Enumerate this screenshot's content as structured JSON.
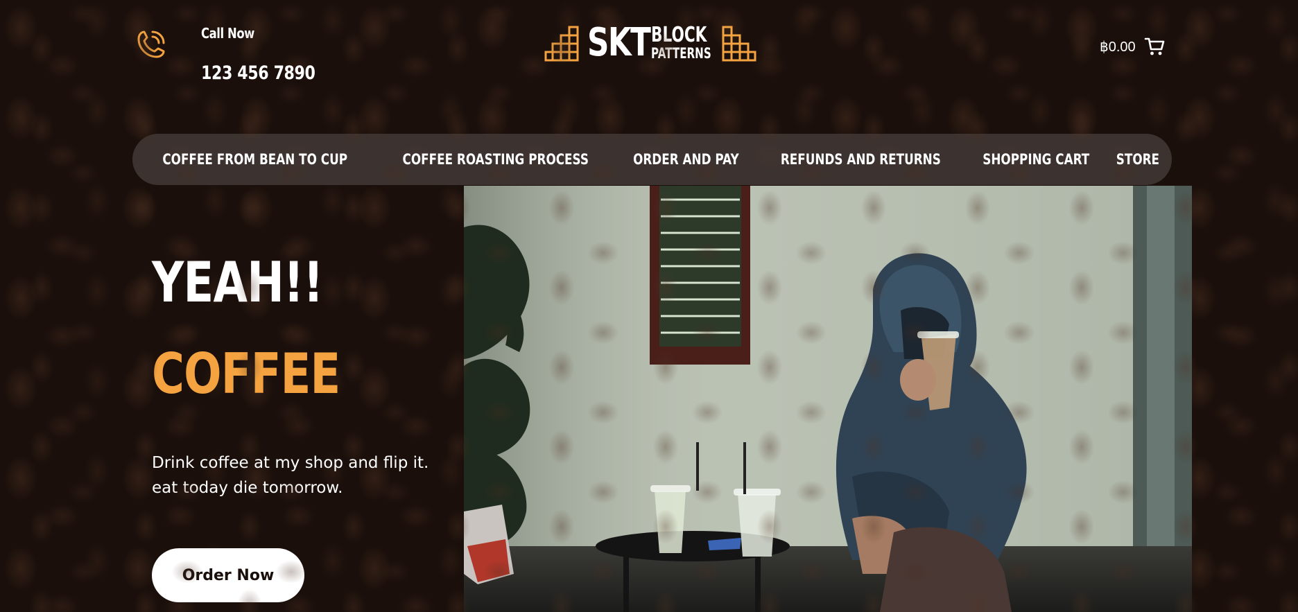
{
  "header": {
    "call_label": "Call Now",
    "call_number": "123 456 7890",
    "phone_icon": "phone-ringing-icon",
    "logo": {
      "main": "SKT",
      "line1": "BLOCK",
      "line2": "PATTERNS"
    },
    "cart_total": "฿0.00",
    "cart_icon": "shopping-cart-icon"
  },
  "nav": {
    "items": [
      {
        "label": "Coffee From Bean To Cup"
      },
      {
        "label": "Coffee Roasting Process"
      },
      {
        "label": "Order And Pay"
      },
      {
        "label": "Refunds And Returns"
      },
      {
        "label": "Shopping Cart"
      },
      {
        "label": "Store"
      }
    ]
  },
  "hero": {
    "title_line1": "YEAH!!",
    "title_line2": "COFFEE",
    "description": "Drink coffee at my shop and flip it. eat today die tomorrow.",
    "cta_label": "Order Now"
  },
  "colors": {
    "accent": "#f4a340",
    "background": "#1a0f0b",
    "nav_bg": "#463c3a",
    "button_bg": "#ffffff"
  }
}
